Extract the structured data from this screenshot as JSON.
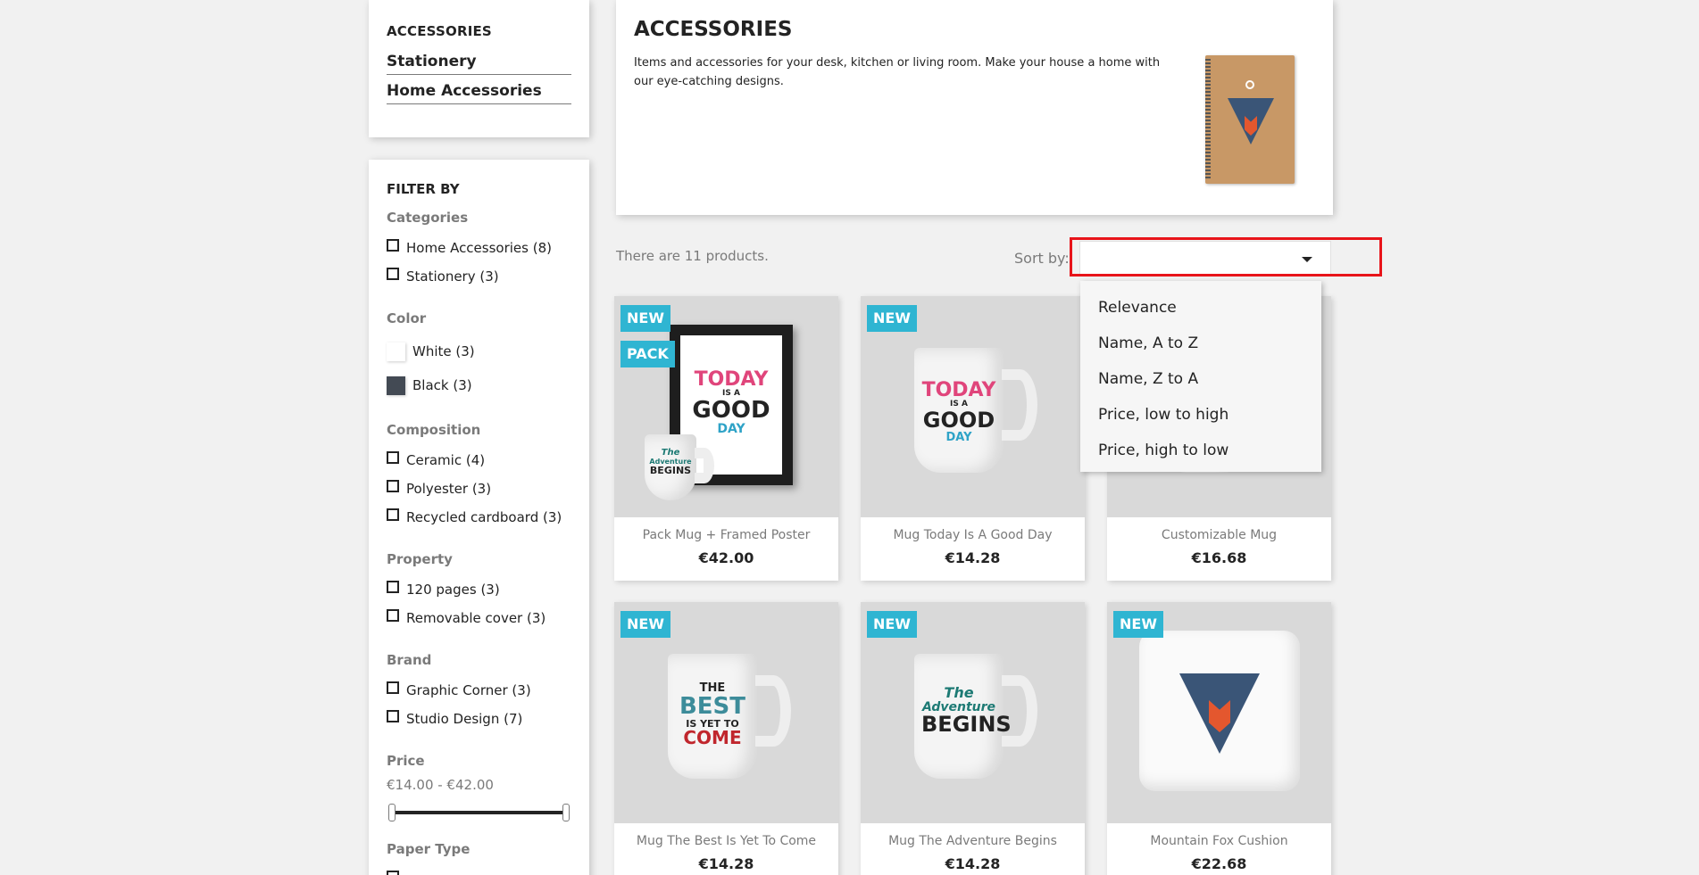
{
  "category_block": {
    "title": "ACCESSORIES",
    "links": [
      "Stationery",
      "Home Accessories"
    ]
  },
  "filters": {
    "title": "FILTER BY",
    "categories": {
      "title": "Categories",
      "items": [
        "Home Accessories (8)",
        "Stationery (3)"
      ]
    },
    "color": {
      "title": "Color",
      "items": [
        {
          "label": "White (3)",
          "color": "#ffffff"
        },
        {
          "label": "Black (3)",
          "color": "#434a54"
        }
      ]
    },
    "composition": {
      "title": "Composition",
      "items": [
        "Ceramic (4)",
        "Polyester (3)",
        "Recycled cardboard (3)"
      ]
    },
    "property": {
      "title": "Property",
      "items": [
        "120 pages (3)",
        "Removable cover (3)"
      ]
    },
    "brand": {
      "title": "Brand",
      "items": [
        "Graphic Corner (3)",
        "Studio Design (7)"
      ]
    },
    "price": {
      "title": "Price",
      "range": "€14.00 - €42.00"
    },
    "paper_type": {
      "title": "Paper Type"
    }
  },
  "header": {
    "title": "ACCESSORIES",
    "description": "Items and accessories for your desk, kitchen or living room. Make your house a home with our eye-catching designs."
  },
  "listing": {
    "count_text": "There are 11 products.",
    "sort_label": "Sort by:",
    "sort_value": "",
    "sort_options": [
      "Relevance",
      "Name, A to Z",
      "Name, Z to A",
      "Price, low to high",
      "Price, high to low"
    ]
  },
  "products": [
    {
      "name": "Pack Mug + Framed Poster",
      "price": "€42.00",
      "flags": [
        "NEW",
        "PACK"
      ]
    },
    {
      "name": "Mug Today Is A Good Day",
      "price": "€14.28",
      "flags": [
        "NEW"
      ]
    },
    {
      "name": "Customizable Mug",
      "price": "€16.68",
      "flags": []
    },
    {
      "name": "Mug The Best Is Yet To Come",
      "price": "€14.28",
      "flags": [
        "NEW"
      ]
    },
    {
      "name": "Mug The Adventure Begins",
      "price": "€14.28",
      "flags": [
        "NEW"
      ]
    },
    {
      "name": "Mountain Fox Cushion",
      "price": "€22.68",
      "flags": [
        "NEW"
      ]
    }
  ],
  "artwork": {
    "today": [
      "TODAY",
      "IS A",
      "GOOD",
      "DAY"
    ],
    "best": [
      "THE",
      "BEST",
      "IS YET TO",
      "COME"
    ],
    "adventure": [
      "The",
      "Adventure",
      "BEGINS"
    ]
  },
  "colors": {
    "accent": "#2fb5d2",
    "highlight": "#e8141a",
    "text": "#232323",
    "muted": "#7a7a7a"
  }
}
